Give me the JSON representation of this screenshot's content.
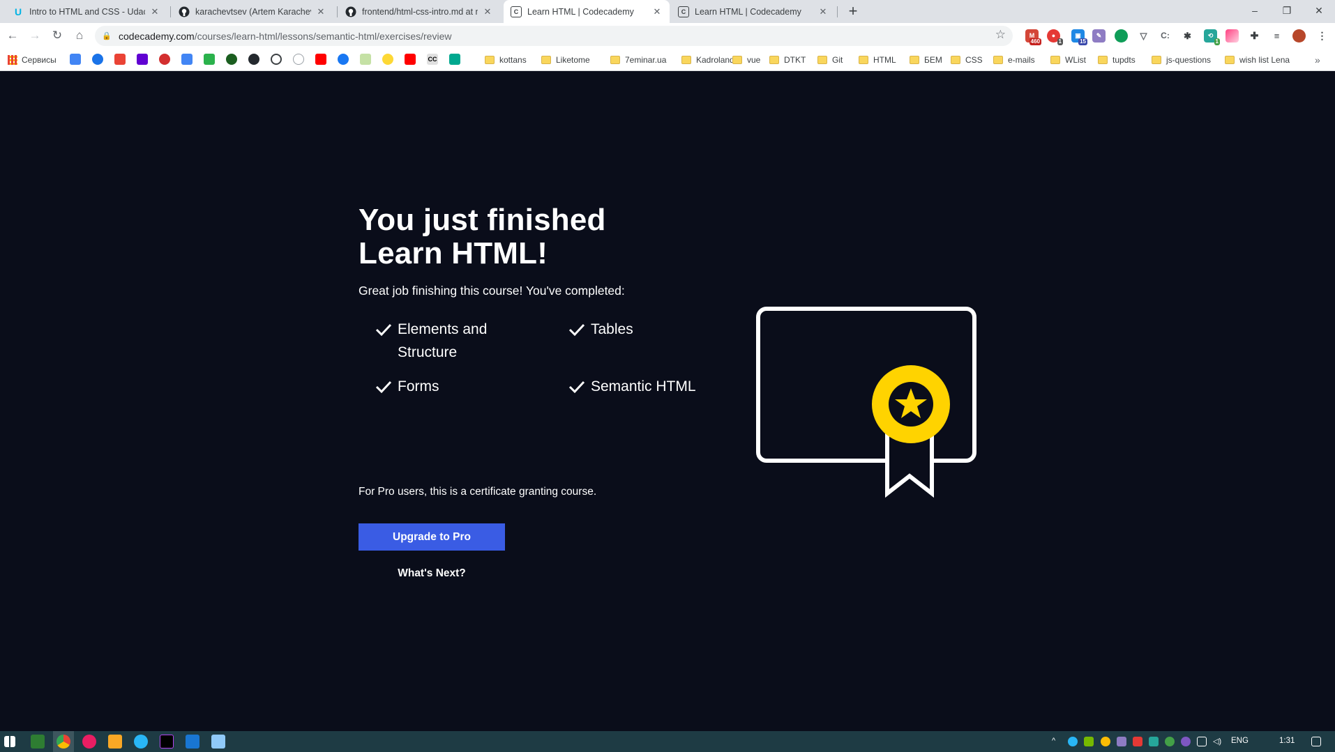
{
  "browser": {
    "tabs": [
      {
        "title": "Intro to HTML and CSS - Udacity",
        "favicon": "udacity-icon"
      },
      {
        "title": "karachevtsev (Artem Karachevtsev)",
        "favicon": "github-icon"
      },
      {
        "title": "frontend/html-css-intro.md at m",
        "favicon": "github-icon"
      },
      {
        "title": "Learn HTML | Codecademy",
        "favicon": "codecademy-icon",
        "active": true
      },
      {
        "title": "Learn HTML | Codecademy",
        "favicon": "codecademy-icon"
      }
    ],
    "url": {
      "domain": "codecademy.com",
      "path": "/courses/learn-html/lessons/semantic-html/exercises/review"
    },
    "extension_badges": {
      "mail": "460",
      "ext2": "1",
      "ext3": "15",
      "ext4": "1"
    },
    "bookmarks": {
      "apps": "Сервисы",
      "folders": [
        "kottans",
        "Liketome",
        "7eminar.ua",
        "Kadroland",
        "vue",
        "DTKT",
        "Git",
        "HTML",
        "БЕМ",
        "CSS",
        "e-mails",
        "WList",
        "tupdts",
        "js-questions",
        "wish list Lena"
      ],
      "cc_label": "CC"
    }
  },
  "page": {
    "headline_line1": "You just finished",
    "headline_line2": "Learn HTML!",
    "lead": "Great job finishing this course! You've completed:",
    "completed": [
      {
        "line1": "Elements and",
        "line2": "Structure"
      },
      {
        "line1": "Tables",
        "line2": ""
      },
      {
        "line1": "Forms",
        "line2": ""
      },
      {
        "line1": "Semantic HTML",
        "line2": ""
      }
    ],
    "pro_note": "For Pro users, this is a certificate granting course.",
    "upgrade_button": "Upgrade to Pro",
    "whats_next": "What's Next?"
  },
  "taskbar": {
    "language": "ENG",
    "time": "1:31"
  },
  "colors": {
    "page_bg": "#0a0d1a",
    "button_blue": "#3a5ce4",
    "medal_yellow": "#ffd300",
    "taskbar_bg": "#1e3b44"
  }
}
